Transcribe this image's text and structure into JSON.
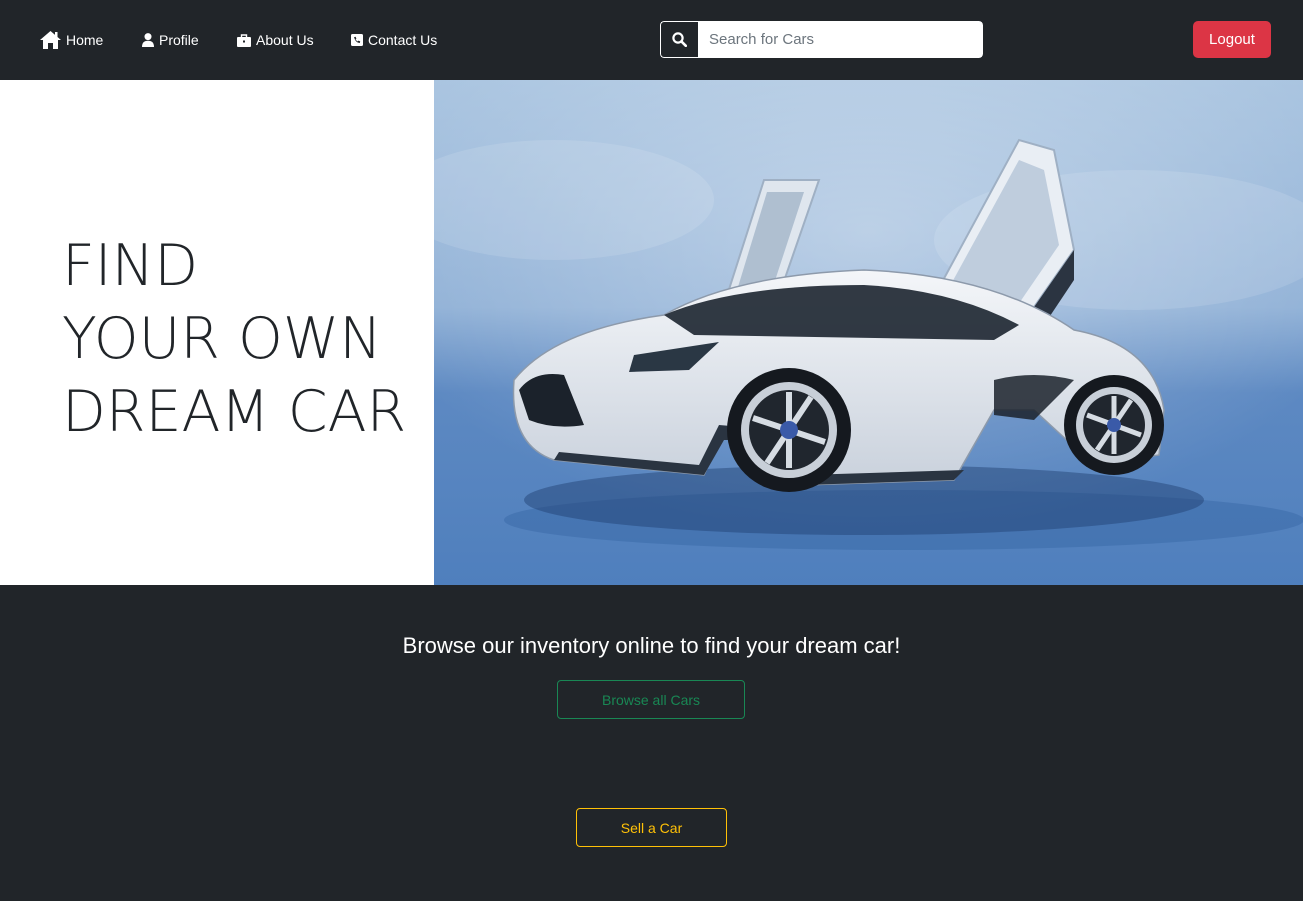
{
  "nav": {
    "items": [
      {
        "label": "Home",
        "icon": "home-icon"
      },
      {
        "label": "Profile",
        "icon": "user-icon"
      },
      {
        "label": "About Us",
        "icon": "briefcase-icon"
      },
      {
        "label": "Contact Us",
        "icon": "phone-square-icon"
      }
    ],
    "search": {
      "placeholder": "Search for Cars",
      "value": "",
      "icon": "search-icon"
    },
    "logout_label": "Logout"
  },
  "hero": {
    "heading_lines": [
      "FIND",
      "YOUR OWN",
      "DREAM CAR"
    ]
  },
  "cta": {
    "text": "Browse our inventory online to find your dream car!",
    "browse_label": "Browse all Cars",
    "sell_label": "Sell a Car"
  },
  "colors": {
    "background": "#212529",
    "danger": "#dc3545",
    "success": "#198754",
    "warning": "#ffc107"
  }
}
